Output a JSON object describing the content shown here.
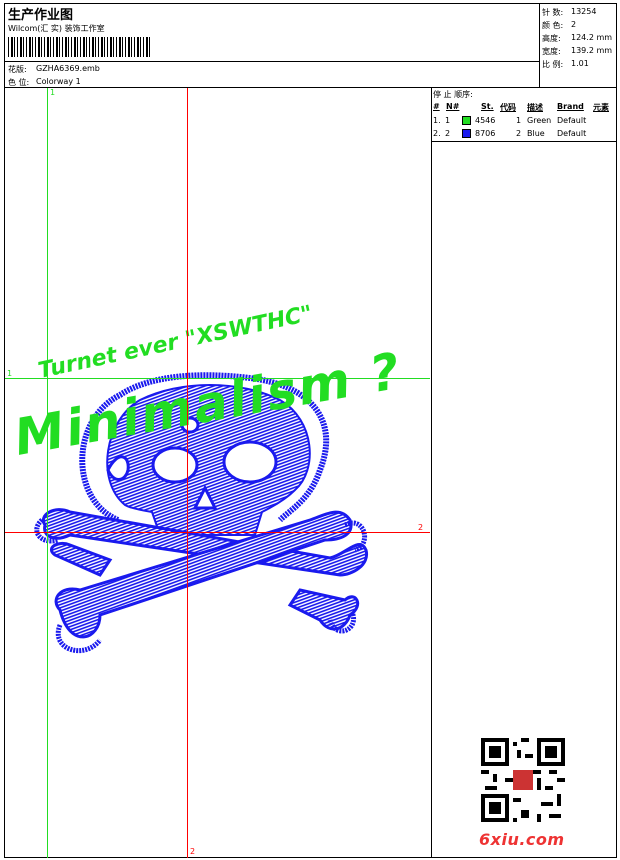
{
  "header": {
    "title": "生产作业图",
    "studio": "Wilcom(汇 实) 装饰工作室",
    "design_label": "花版:",
    "design_file": "GZHA6369.emb",
    "colorway_label": "色 位:",
    "colorway": "Colorway 1"
  },
  "stats": {
    "stitches_label": "针 数:",
    "stitches": "13254",
    "colors_label": "颜 色:",
    "colors": "2",
    "height_label": "高度:",
    "height": "124.2 mm",
    "width_label": "宽度:",
    "width": "139.2 mm",
    "scale_label": "比 例:",
    "scale": "1.01"
  },
  "stop_sequence": {
    "title": "停 止 顺序:",
    "columns": [
      "#",
      "N#",
      "St.",
      "代码",
      "描述",
      "Brand",
      "元素"
    ],
    "rows": [
      {
        "num": "1.",
        "n": "1",
        "swatch": "#22dd22",
        "stitches": "4546",
        "code": "1",
        "desc": "Green",
        "brand": "Default"
      },
      {
        "num": "2.",
        "n": "2",
        "swatch": "#1a1aee",
        "stitches": "8706",
        "code": "2",
        "desc": "Blue",
        "brand": "Default"
      }
    ]
  },
  "guides": {
    "green_v_label": "1",
    "green_h_label": "1",
    "red_h_label": "2",
    "red_v_label": "2"
  },
  "design": {
    "top_text": "Turnet ever \"XSWTHC\"",
    "main_text": "Minimalism ?"
  },
  "colors": {
    "green": "#22dd22",
    "blue": "#1a1aee",
    "red": "#ff0000"
  },
  "watermark": "6xiu.com"
}
